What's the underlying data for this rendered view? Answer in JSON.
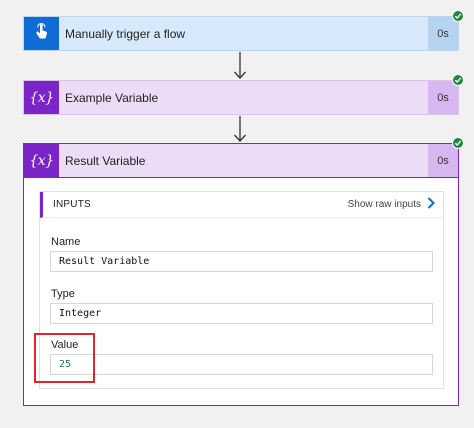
{
  "flow": {
    "steps": [
      {
        "title": "Manually trigger a flow",
        "duration": "0s",
        "icon": "touch-icon",
        "status": "succeeded"
      },
      {
        "title": "Example Variable",
        "duration": "0s",
        "icon": "variable-icon",
        "status": "succeeded"
      },
      {
        "title": "Result Variable",
        "duration": "0s",
        "icon": "variable-icon",
        "status": "succeeded"
      }
    ],
    "variable_icon_text": "{x}"
  },
  "result_panel": {
    "inputs_title": "INPUTS",
    "show_raw_inputs": "Show raw inputs",
    "fields": {
      "name": {
        "label": "Name",
        "value": "Result Variable"
      },
      "type": {
        "label": "Type",
        "value": "Integer"
      },
      "value": {
        "label": "Value",
        "value": "25"
      }
    }
  },
  "colors": {
    "trigger_accent": "#0f6cd6",
    "variable_accent": "#7b25c8",
    "success_check": "#1b8a3a",
    "highlight": "#e0262b"
  }
}
